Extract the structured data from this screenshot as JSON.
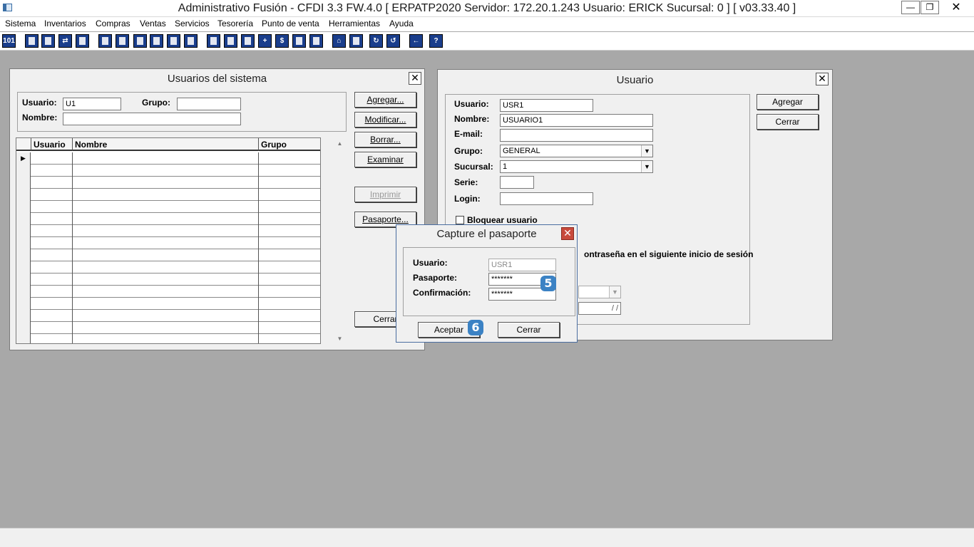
{
  "window": {
    "title": "Administrativo Fusión - CFDI 3.3 FW.4.0 [ ERPATP2020   Servidor: 172.20.1.243    Usuario: ERICK     Sucursal: 0 ] [ v03.33.40 ]",
    "min_label": "—",
    "restore_label": "❐",
    "close_label": "✕"
  },
  "menu": [
    "Sistema",
    "Inventarios",
    "Compras",
    "Ventas",
    "Servicios",
    "Tesorería",
    "Punto de venta",
    "Herramientas",
    "Ayuda"
  ],
  "toolbar": {
    "icons": [
      "id-card-icon",
      "copy-icon",
      "clipboard-icon",
      "transfer-icon",
      "search-doc-icon",
      "user-icon",
      "folder-icon",
      "doc-back-icon",
      "printer-icon",
      "document-icon",
      "list-doc-icon",
      "people-icon",
      "folder-open-icon",
      "doc-forward-icon",
      "add-doc-icon",
      "dollar-icon",
      "report-icon",
      "table-icon",
      "home-icon",
      "zoom-icon",
      "refresh-icon",
      "undo-icon",
      "arrow-left-icon",
      "help-icon"
    ]
  },
  "usuarios_dialog": {
    "title": "Usuarios del sistema",
    "close_label": "✕",
    "filter": {
      "usuario_label": "Usuario:",
      "usuario_value": "U1",
      "grupo_label": "Grupo:",
      "grupo_value": "",
      "nombre_label": "Nombre:",
      "nombre_value": ""
    },
    "buttons": {
      "agregar": "Agregar...",
      "modificar": "Modificar...",
      "borrar": "Borrar...",
      "examinar": "Examinar",
      "imprimir": "Imprimir",
      "pasaporte": "Pasaporte...",
      "cerrar": "Cerrar"
    },
    "grid": {
      "columns": [
        "Usuario",
        "Nombre",
        "Grupo"
      ],
      "current_row_marker": "▶",
      "scroll_up": "▲",
      "scroll_down": "▼"
    }
  },
  "usuario_dialog": {
    "title": "Usuario",
    "close_label": "✕",
    "fields": {
      "usuario_label": "Usuario:",
      "usuario_value": "USR1",
      "nombre_label": "Nombre:",
      "nombre_value": "USUARIO1",
      "email_label": "E-mail:",
      "email_value": "",
      "grupo_label": "Grupo:",
      "grupo_value": "GENERAL",
      "sucursal_label": "Sucursal:",
      "sucursal_value": "1",
      "serie_label": "Serie:",
      "serie_value": "",
      "login_label": "Login:",
      "login_value": ""
    },
    "bloquear_label": "Bloquear usuario",
    "cambiar_contrasena_label": "ontraseña en el siguiente inicio de sesión",
    "date_value": "/ /",
    "dropdown_arrow": "▼",
    "buttons": {
      "agregar": "Agregar",
      "cerrar": "Cerrar"
    }
  },
  "pasaporte_dialog": {
    "title": "Capture el pasaporte",
    "close_label": "✕",
    "usuario_label": "Usuario:",
    "usuario_value": "USR1",
    "pasaporte_label": "Pasaporte:",
    "pasaporte_value": "*******",
    "confirmacion_label": "Confirmación:",
    "confirmacion_value": "*******",
    "buttons": {
      "aceptar": "Aceptar",
      "cerrar": "Cerrar"
    }
  },
  "badges": {
    "step5": "5",
    "step6": "6",
    "color": "#3b82c4"
  }
}
